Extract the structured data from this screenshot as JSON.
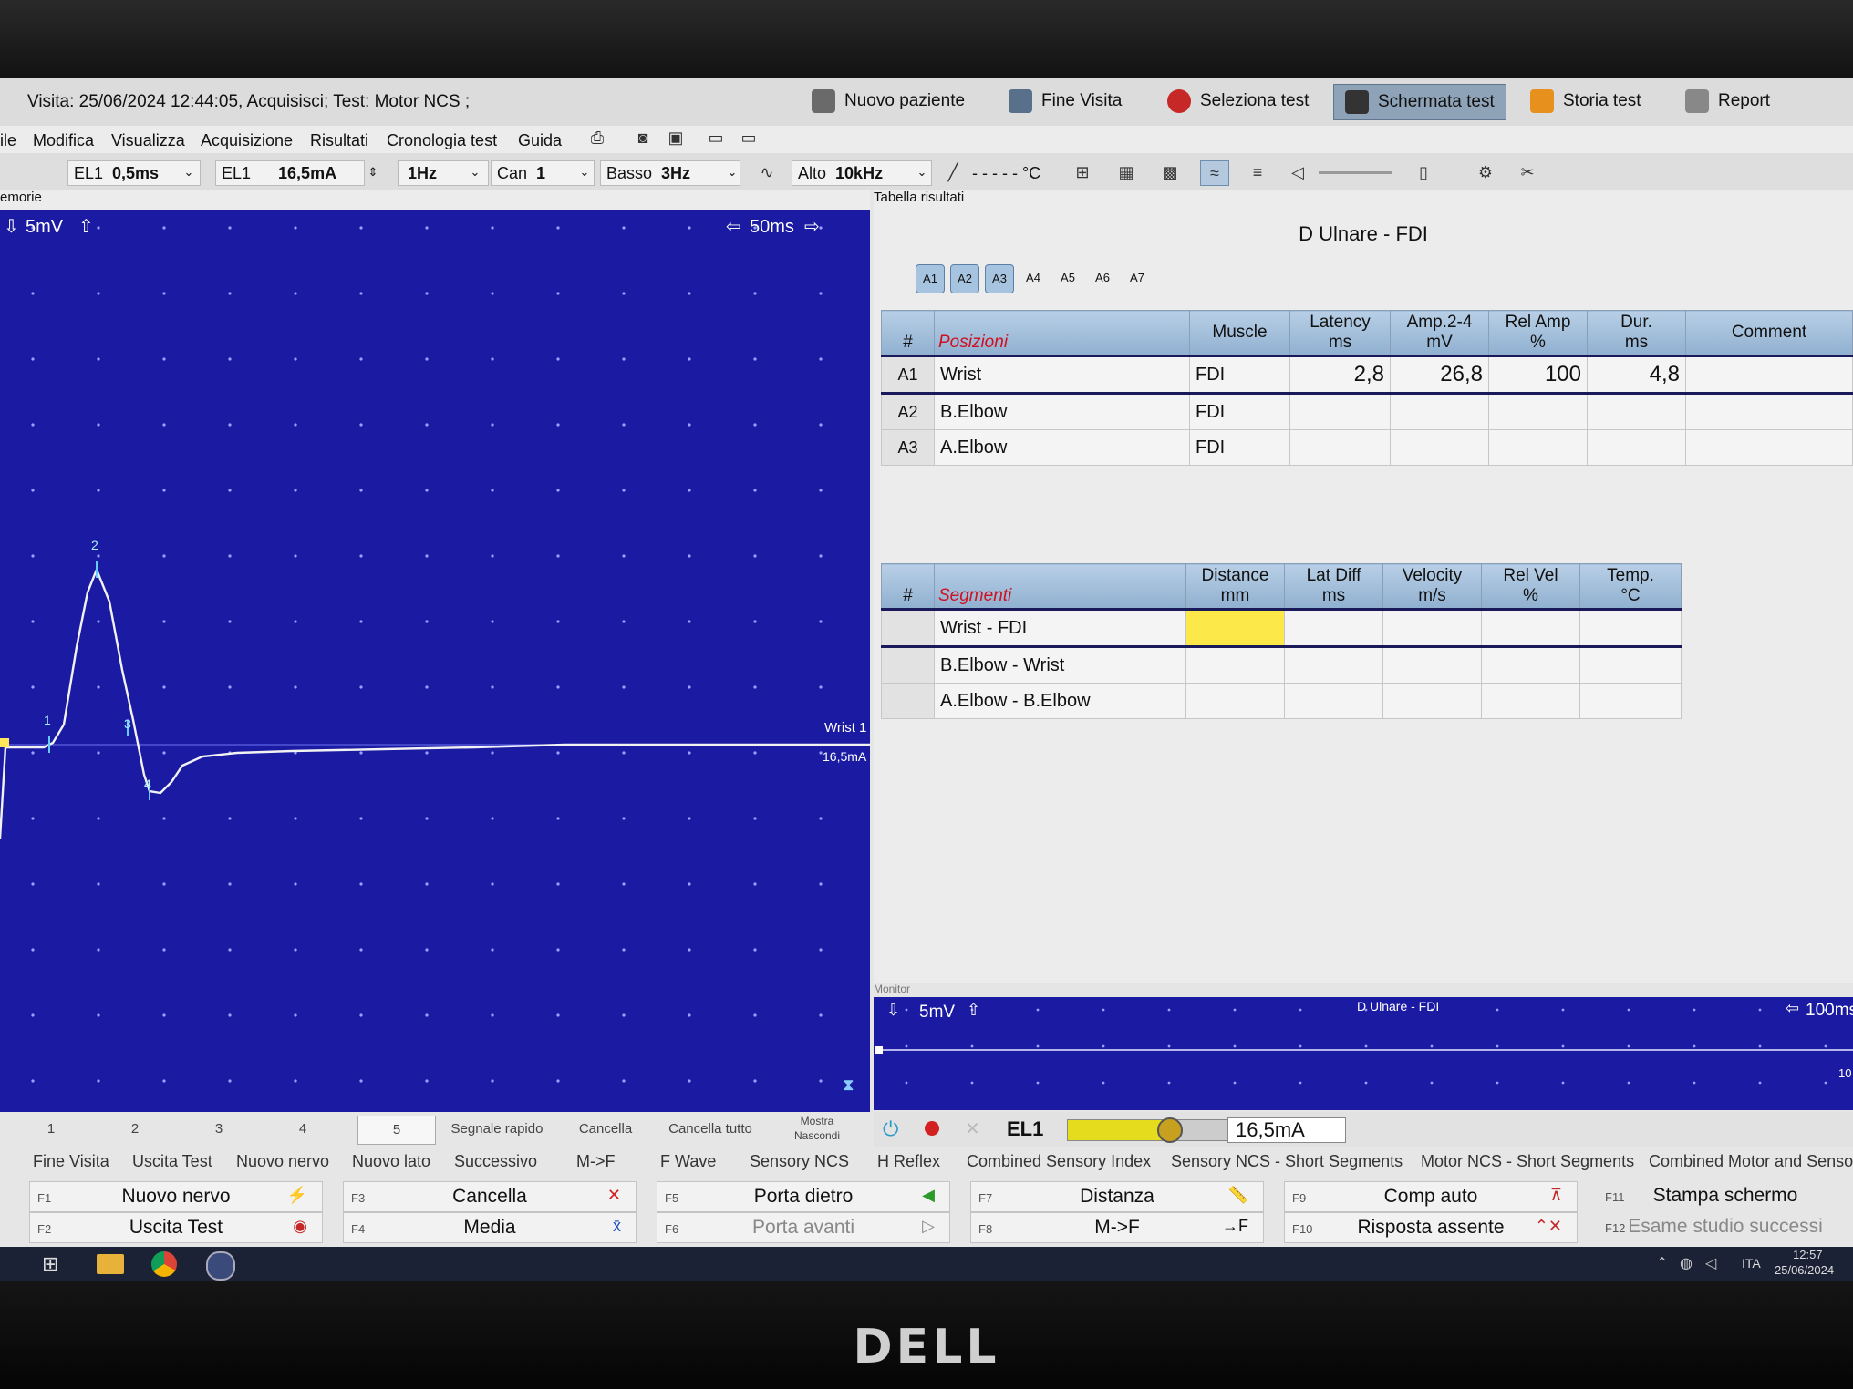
{
  "title": "Visita: 25/06/2024 12:44:05, Acquisisci; Test: Motor NCS ;",
  "topbuttons": {
    "nuovo_paziente": "Nuovo paziente",
    "fine_visita": "Fine Visita",
    "seleziona_test": "Seleziona test",
    "schermata_test": "Schermata test",
    "storia_test": "Storia test",
    "report": "Report"
  },
  "menu": {
    "file": "ile",
    "modifica": "Modifica",
    "visualizza": "Visualizza",
    "acquisizione": "Acquisizione",
    "risultati": "Risultati",
    "cronologia": "Cronologia test",
    "guida": "Guida"
  },
  "toolbar": {
    "el1_a": "EL1",
    "dur": "0,5ms",
    "el1_b": "EL1",
    "intensity": "16,5mA",
    "rate": "1Hz",
    "can_label": "Can",
    "can_value": "1",
    "low_label": "Basso",
    "low_value": "3Hz",
    "high_label": "Alto",
    "high_value": "10kHz",
    "temp": "- - - - - °C"
  },
  "panels": {
    "memorie": "emorie",
    "tabella": "Tabella risultati",
    "monitor": "Monitor"
  },
  "wave": {
    "gain": "5mV",
    "time": "50ms",
    "trace_label": "Wrist 1",
    "trace_intensity": "16,5mA",
    "markers": [
      "1",
      "2",
      "3",
      "4"
    ]
  },
  "results": {
    "title": "D Ulnare - FDI",
    "abuttons": [
      "A1",
      "A2",
      "A3",
      "A4",
      "A5",
      "A6",
      "A7"
    ],
    "pos_headers": {
      "hash": "#",
      "section": "Posizioni",
      "muscle": "Muscle",
      "latency": "Latency",
      "latency_u": "ms",
      "amp": "Amp.2-4",
      "amp_u": "mV",
      "relamp": "Rel Amp",
      "relamp_u": "%",
      "dur": "Dur.",
      "dur_u": "ms",
      "comment": "Comment"
    },
    "positions": [
      {
        "id": "A1",
        "site": "Wrist",
        "muscle": "FDI",
        "latency": "2,8",
        "amp": "26,8",
        "relamp": "100",
        "dur": "4,8"
      },
      {
        "id": "A2",
        "site": "B.Elbow",
        "muscle": "FDI",
        "latency": "",
        "amp": "",
        "relamp": "",
        "dur": ""
      },
      {
        "id": "A3",
        "site": "A.Elbow",
        "muscle": "FDI",
        "latency": "",
        "amp": "",
        "relamp": "",
        "dur": ""
      }
    ],
    "seg_headers": {
      "hash": "#",
      "section": "Segmenti",
      "distance": "Distance",
      "distance_u": "mm",
      "latdiff": "Lat Diff",
      "latdiff_u": "ms",
      "velocity": "Velocity",
      "velocity_u": "m/s",
      "relvel": "Rel Vel",
      "relvel_u": "%",
      "temp": "Temp.",
      "temp_u": "°C"
    },
    "segments": [
      "Wrist - FDI",
      "B.Elbow - Wrist",
      "A.Elbow - B.Elbow"
    ]
  },
  "monitor": {
    "gain": "5mV",
    "title": "D Ulnare - FDI",
    "time": "100ms",
    "edge": "10"
  },
  "tabs": [
    "1",
    "2",
    "3",
    "4",
    "5"
  ],
  "actions": {
    "segnale": "Segnale rapido",
    "cancella": "Cancella",
    "cancella_tutto": "Cancella tutto",
    "mostra": "Mostra",
    "nascondi": "Nascondi"
  },
  "stim": {
    "channel": "EL1",
    "value": "16,5mA",
    "level": 0.6
  },
  "tests": [
    "Fine Visita",
    "Uscita Test",
    "Nuovo nervo",
    "Nuovo lato",
    "Successivo",
    "M->F",
    "F  Wave",
    "Sensory NCS",
    "H Reflex",
    "Combined Sensory Index",
    "Sensory NCS - Short Segments",
    "Motor NCS - Short Segments",
    "Combined Motor and Sensory"
  ],
  "fkeys": [
    {
      "key": "F1",
      "label": "Nuovo nervo"
    },
    {
      "key": "F2",
      "label": "Uscita Test"
    },
    {
      "key": "F3",
      "label": "Cancella"
    },
    {
      "key": "F4",
      "label": "Media"
    },
    {
      "key": "F5",
      "label": "Porta dietro"
    },
    {
      "key": "F6",
      "label": "Porta avanti"
    },
    {
      "key": "F7",
      "label": "Distanza"
    },
    {
      "key": "F8",
      "label": "M->F"
    },
    {
      "key": "F9",
      "label": "Comp auto"
    },
    {
      "key": "F10",
      "label": "Risposta assente"
    },
    {
      "key": "F11",
      "label": "Stampa schermo"
    },
    {
      "key": "F12",
      "label": "Esame studio successi"
    }
  ],
  "tray": {
    "lang": "ITA",
    "time": "12:57",
    "date": "25/06/2024"
  },
  "brand": "DELL"
}
